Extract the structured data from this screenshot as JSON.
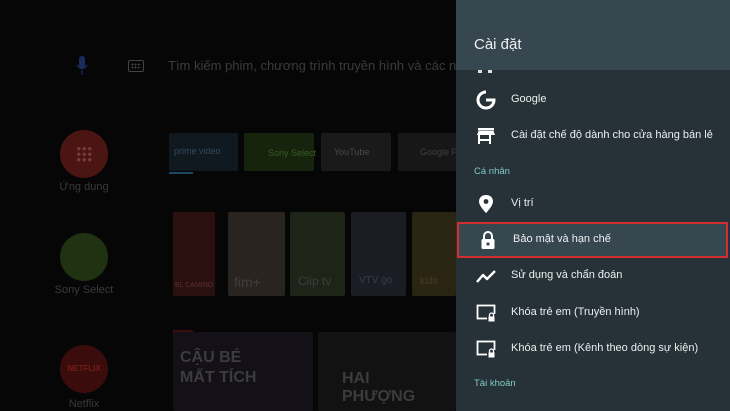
{
  "home": {
    "search_placeholder": "Tìm kiếm phim, chương trình truyền hình và các nội d",
    "apps": [
      {
        "label": "Ứng dụng"
      },
      {
        "label": "Sony Select"
      },
      {
        "label": "Netflix",
        "badge": "NETFLIX"
      }
    ],
    "channels": [
      {
        "label": "prime video"
      },
      {
        "label": "Sony Select"
      },
      {
        "label": "YouTube"
      },
      {
        "label": "Google Play"
      }
    ],
    "content": [
      {
        "label": "EL CAMINO"
      },
      {
        "label": "fim+"
      },
      {
        "label": "Clip tv"
      },
      {
        "label": "VTV go"
      },
      {
        "label": "kids"
      }
    ],
    "netflix_row": [
      {
        "title": "CẬU BÉ MẤT TÍCH"
      },
      {
        "title": "HAI PHƯỢNG"
      }
    ]
  },
  "settings": {
    "title": "Cài đặt",
    "items_top": [
      {
        "label": "Google",
        "icon": "google-icon"
      },
      {
        "label": "Cài đặt chế độ dành cho cửa hàng bán lẻ",
        "icon": "store-icon"
      }
    ],
    "section_personal": "Cá nhân",
    "items_personal": [
      {
        "label": "Vị trí",
        "icon": "location-pin-icon"
      },
      {
        "label": "Bảo mật và hạn chế",
        "icon": "lock-icon",
        "selected": true
      },
      {
        "label": "Sử dụng và chẩn đoán",
        "icon": "trending-line-icon"
      },
      {
        "label": "Khóa trẻ em (Truyền hình)",
        "icon": "screen-lock-icon"
      },
      {
        "label": "Khóa trẻ em (Kênh theo dòng sự kiện)",
        "icon": "screen-lock-icon"
      }
    ],
    "section_account": "Tài khoản"
  },
  "colors": {
    "panel_bg": "#263238",
    "header_bg": "#37474f",
    "section_text": "#80cbc4",
    "selection_border": "#d32f2f"
  }
}
